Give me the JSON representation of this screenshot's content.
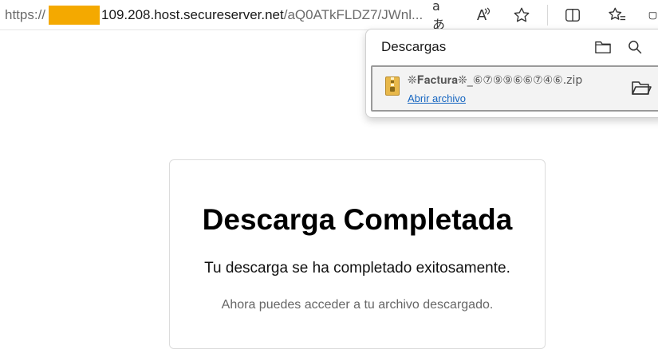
{
  "address_bar": {
    "scheme": "https://",
    "host": "109.208.host.secureserver.net",
    "path": "/aQ0ATkFLDZ7/JWnl..."
  },
  "toolbar": {
    "read_aloud_label": "aあ",
    "immersive_reader_label": "A"
  },
  "downloads": {
    "title": "Descargas",
    "item": {
      "file_name": "❊𝐅𝐚𝐜𝐭𝐮𝐫𝐚❊_⑥⑦⑨⑨⑥⑥⑦④⑥.zip",
      "open_label": "Abrir archivo"
    }
  },
  "card": {
    "title": "Descarga Completada",
    "message": "Tu descarga se ha completado exitosamente.",
    "note": "Ahora puedes acceder a tu archivo descargado."
  },
  "colors": {
    "redaction": "#f4a900",
    "link": "#1565c0",
    "zip_icon": "#e8b84a"
  }
}
